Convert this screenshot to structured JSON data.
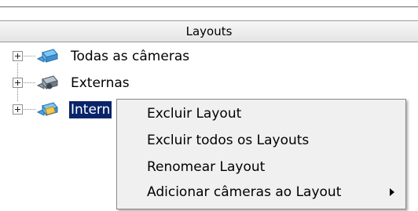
{
  "panel": {
    "title": "Layouts"
  },
  "tree": {
    "items": [
      {
        "label": "Todas as câmeras",
        "icon": "camera-icon"
      },
      {
        "label": "Externas",
        "icon": "camera-icon"
      },
      {
        "label": "Intern",
        "icon": "camera-icon"
      }
    ]
  },
  "context_menu": {
    "items": [
      {
        "label": "Excluir Layout"
      },
      {
        "label": "Excluir todos os Layouts"
      },
      {
        "label": "Renomear Layout"
      },
      {
        "label": "Adicionar câmeras ao Layout",
        "icon": "submenu-arrow-icon"
      }
    ]
  },
  "colors": {
    "selection": "#0a246a",
    "menu_bg": "#f0f0f0"
  }
}
